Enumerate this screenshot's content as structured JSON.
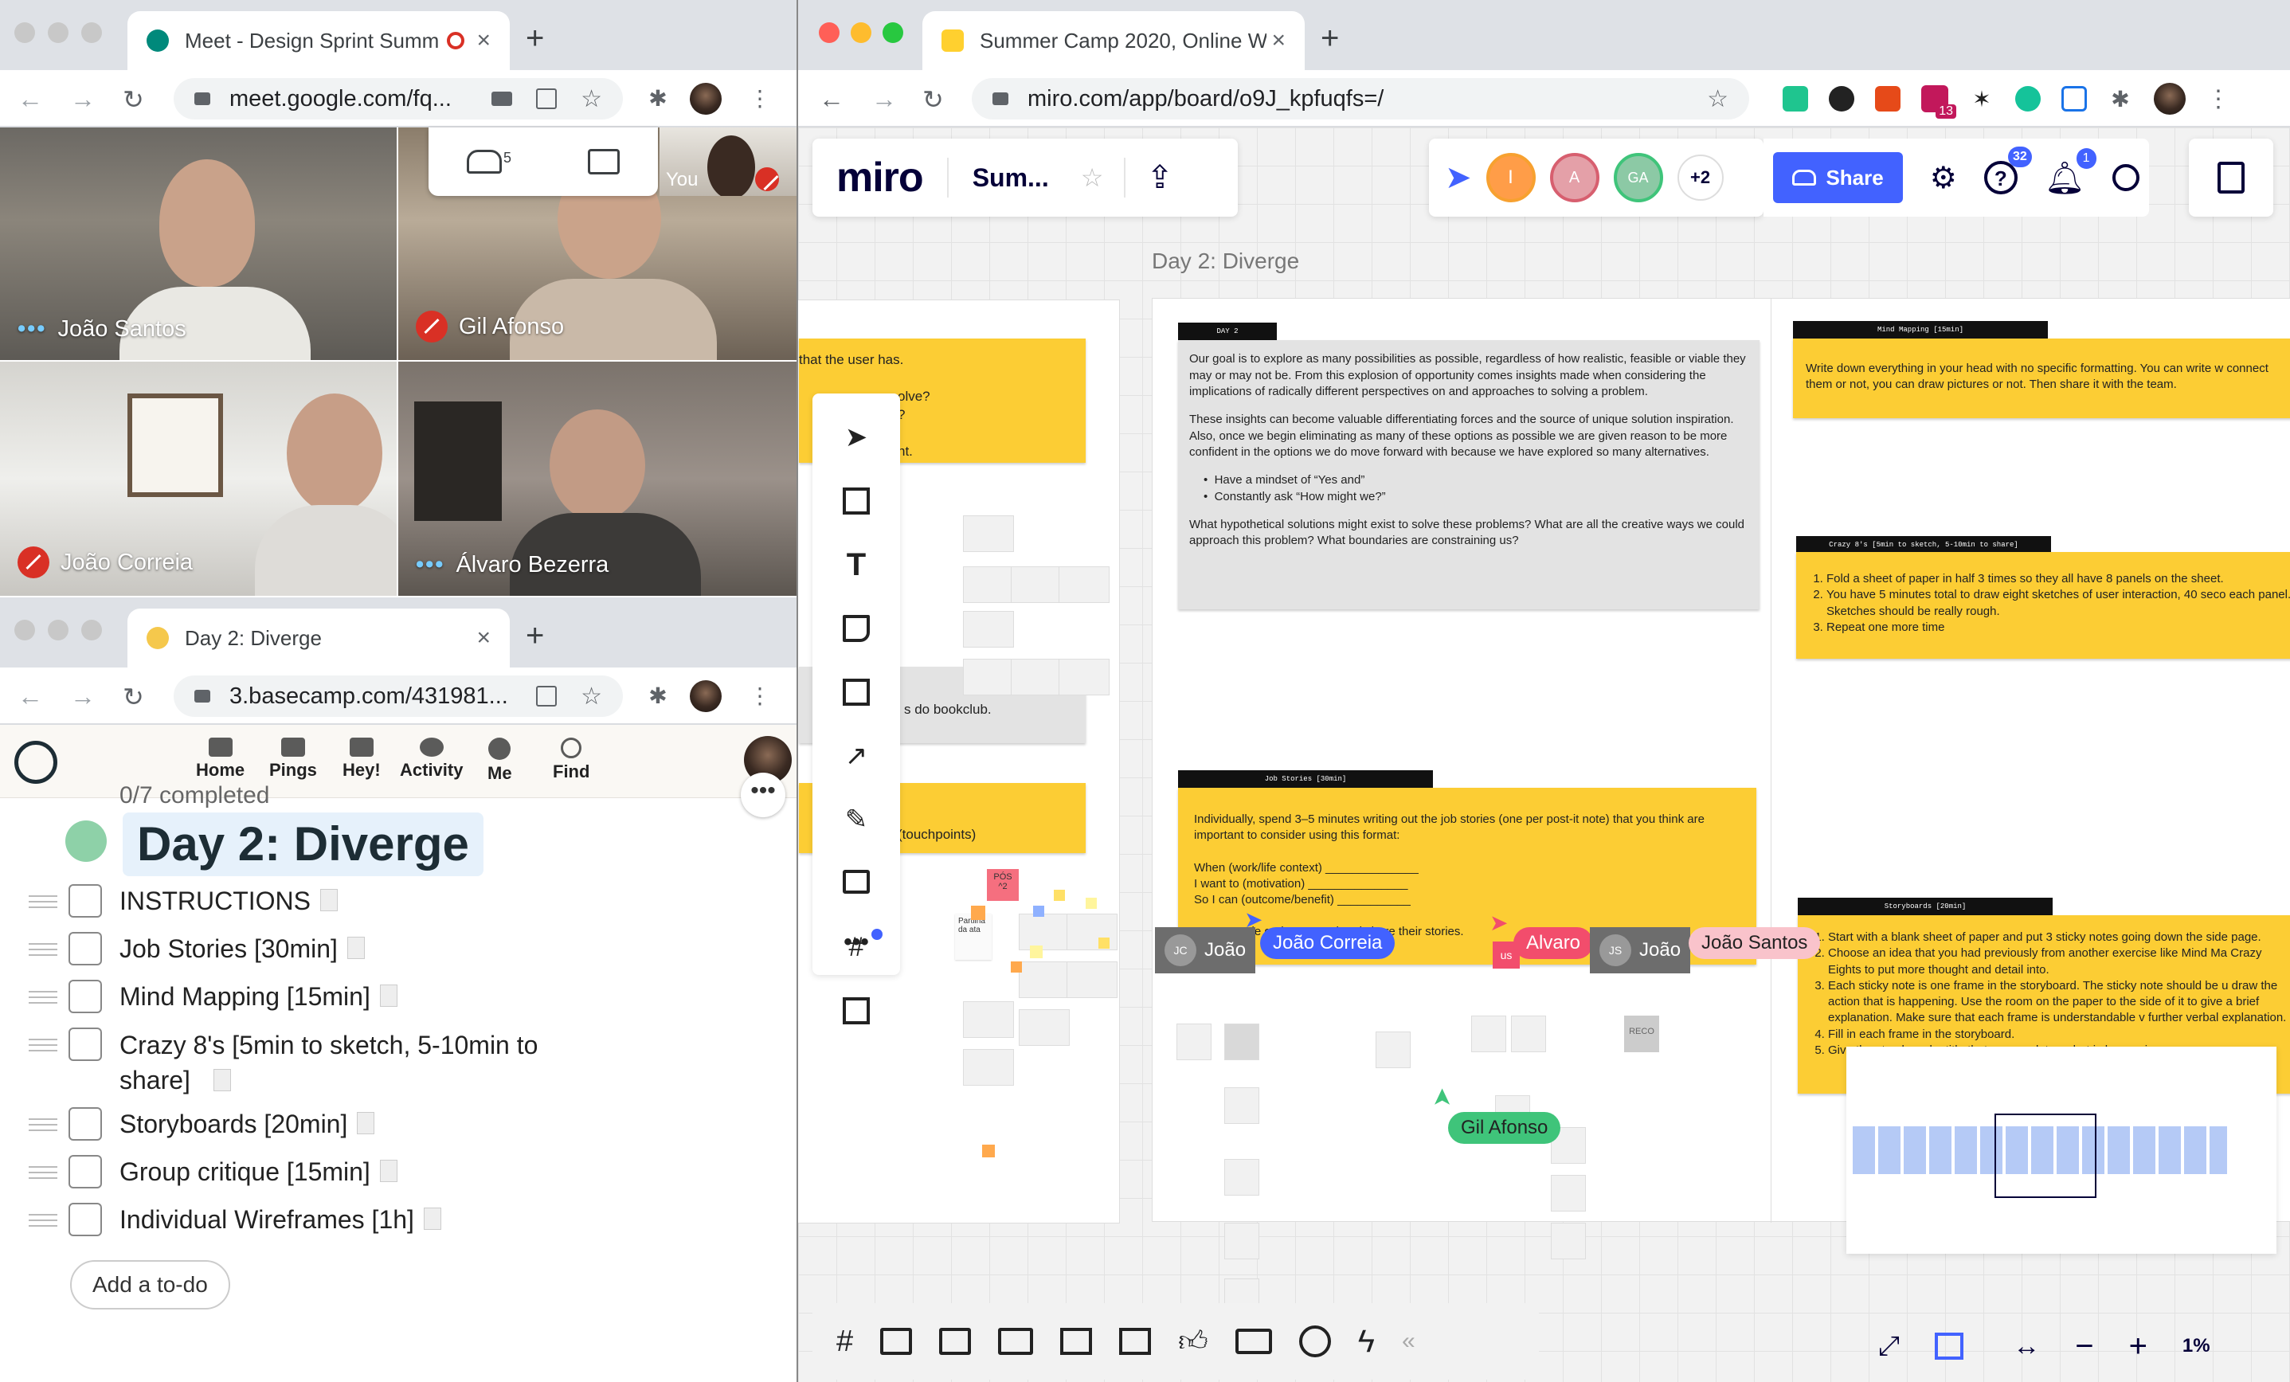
{
  "meet": {
    "tab_title": "Meet - Design Sprint Summ",
    "url": "meet.google.com/fq...",
    "people_count": "5",
    "participants": [
      {
        "name": "João Santos",
        "muted": false
      },
      {
        "name": "Gil Afonso",
        "muted": true
      },
      {
        "name": "João Correia",
        "muted": true
      },
      {
        "name": "Álvaro Bezerra",
        "muted": false
      }
    ],
    "self_label": "You"
  },
  "basecamp": {
    "tab_title": "Day 2: Diverge",
    "url": "3.basecamp.com/431981...",
    "nav": [
      "Home",
      "Pings",
      "Hey!",
      "Activity",
      "Me",
      "Find"
    ],
    "completed": "0/7 completed",
    "list_title": "Day 2: Diverge",
    "todos": [
      "INSTRUCTIONS",
      "Job Stories [30min]",
      "Mind Mapping [15min]",
      "Crazy 8's [5min to sketch, 5-10min to share]",
      "Storyboards [20min]",
      "Group critique [15min]",
      "Individual Wireframes [1h]"
    ],
    "add_todo": "Add a to-do"
  },
  "miro_browser": {
    "tab_title": "Summer Camp 2020, Online W",
    "url": "miro.com/app/board/o9J_kpfuqfs=/",
    "ext_badge": "13"
  },
  "miro": {
    "logo": "miro",
    "board_name": "Sum...",
    "share_label": "Share",
    "help_badge": "32",
    "notif_badge": "1",
    "collab_initials": [
      "I",
      "A",
      "GA"
    ],
    "collab_more": "+2",
    "frame_title": "Day 2: Diverge",
    "zoom": "1%",
    "left_frame": {
      "snippets": [
        "that the user has.",
        "olve?",
        "?",
        "nt.",
        "s do bookclub.",
        "(touchpoints)",
        "PÓS\n^2",
        "Partilha\nda ata"
      ]
    },
    "day2": {
      "label": "DAY 2",
      "intro_p1": "Our goal is to explore as many possibilities as possible, regardless of how realistic, feasible or viable they may or may not be. From this explosion of opportunity comes insights made when considering the implications of radically different perspectives on and approaches to solving a problem.",
      "intro_p2": "These insights can become valuable differentiating forces and the source of unique solution inspiration. Also, once we begin eliminating as many of these options as possible we are given reason to be more confident in the options we do move forward with because we have explored so many alternatives.",
      "bullet1": "Have a mindset of “Yes and”",
      "bullet2": "Constantly ask “How might we?”",
      "intro_p3": "What hypothetical solutions might exist to solve these problems? What are all the creative ways we could approach this problem? What boundaries are constraining us?"
    },
    "job_stories": {
      "label": "Job Stories [30min]",
      "p1": "Individually, spend 3–5 minutes writing out the job stories (one per post-it note) that you think are important to consider using this format:",
      "l1": "When (work/life context) ______________",
      "l2": "I want to (motivation) _______________",
      "l3": "So I can (outcome/benefit) ___________",
      "p2": "Have people gather around and share their stories."
    },
    "mind_mapping": {
      "label": "Mind Mapping [15min]",
      "text": "Write down everything in your head with no specific formatting. You can write w connect them or not, you can draw pictures or not. Then share it with the team."
    },
    "crazy8": {
      "label": "Crazy 8's [5min to sketch, 5-10min to share]",
      "items": [
        "Fold a sheet of paper in half 3 times so they all have 8 panels on the sheet.",
        "You have 5 minutes total to draw eight sketches of user interaction, 40 seco each panel. Sketches should be really rough.",
        "Repeat one more time"
      ]
    },
    "storyboards": {
      "label": "Storyboards [20min]",
      "items": [
        "Start with a blank sheet of paper and put 3 sticky notes going down the side page.",
        "Choose an idea that you had previously from another exercise like Mind Ma Crazy Eights to put more thought and detail into.",
        "Each sticky note is one frame in the storyboard. The sticky note should be u draw the action that is happening. Use the room on the paper to the side of it to give a brief explanation. Make sure that each frame is understandable v further verbal explanation.",
        "Fill in each frame in the storyboard.",
        "Give the storyboard a title that encapsulates what is happening."
      ]
    },
    "cursors": [
      {
        "name": "João Correia",
        "color": "#4262ff"
      },
      {
        "name": "Alvaro",
        "color": "#f24d6c"
      },
      {
        "name": "João Santos",
        "color": "#f9c3cb"
      },
      {
        "name": "Gil Afonso",
        "color": "#3fc47a"
      }
    ],
    "gray_tags": [
      {
        "initials": "JC",
        "name": "João"
      },
      {
        "initials": "JS",
        "name": "João"
      }
    ],
    "reco": "RECO",
    "us": "us"
  }
}
